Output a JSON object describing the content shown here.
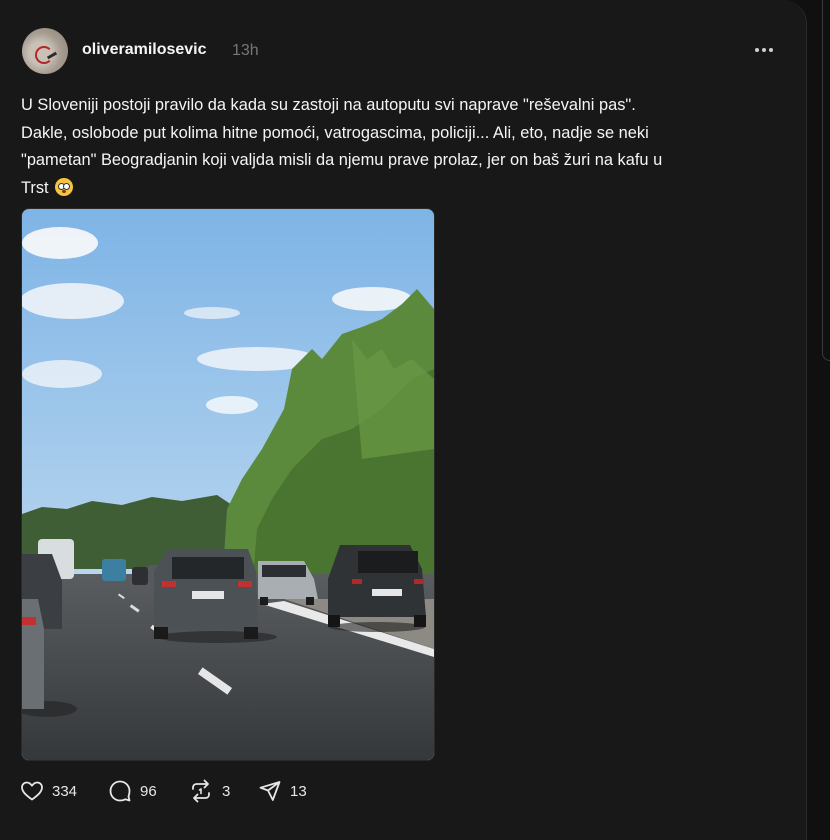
{
  "post": {
    "username": "oliveramilosevic",
    "time": "13h",
    "text_lines": [
      "U Sloveniji postoji pravilo da kada su zastoji na autoputu svi naprave \"reševalni pas\".",
      "Dakle, oslobode put kolima hitne pomoći, vatrogascima, policiji... Ali, eto, nadje se neki",
      "\"pametan\" Beogradjanin koji valjda misli da njemu prave prolaz, jer on baš žuri na kafu u",
      "Trst"
    ],
    "emoji": "face-with-rolling-eyes-emoji"
  },
  "actions": {
    "like_count": "334",
    "reply_count": "96",
    "repost_count": "3",
    "share_count": "13"
  },
  "icons": [
    "more-icon",
    "heart-icon",
    "comment-icon",
    "repost-icon",
    "share-icon"
  ]
}
